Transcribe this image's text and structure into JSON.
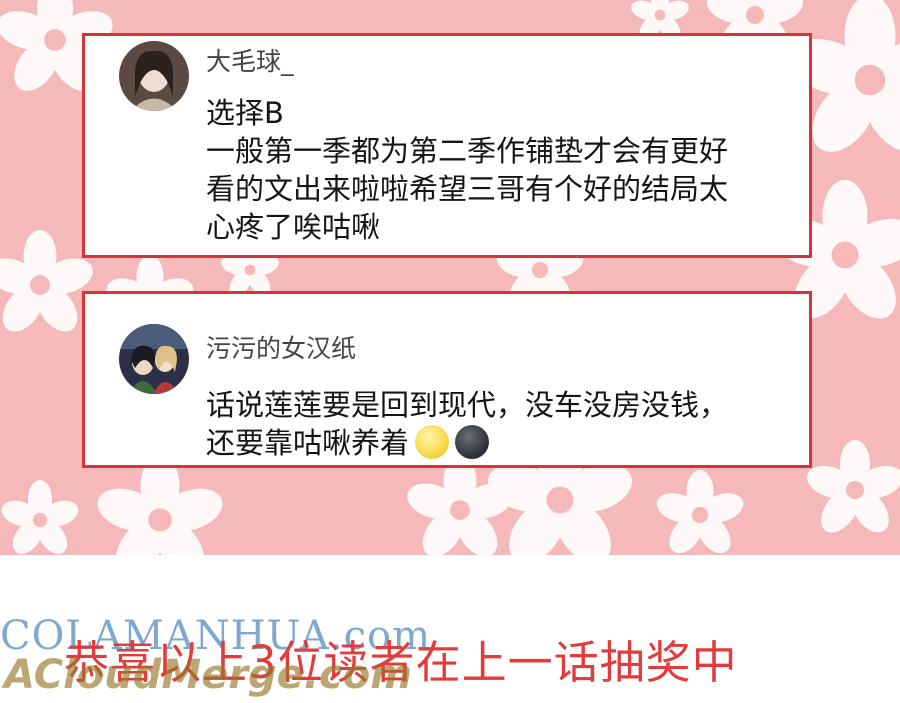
{
  "colors": {
    "background": "#f6b9b9",
    "card_border": "#d6343a",
    "announcement_text": "#e33b3b"
  },
  "comments": [
    {
      "username": "大毛球_",
      "lines": [
        "选择B",
        "一般第一季都为第二季作铺垫才会有更好",
        "看的文出来啦啦希望三哥有个好的结局太",
        "心疼了唉咕啾"
      ]
    },
    {
      "username": "污污的女汉纸",
      "lines": [
        "话说莲莲要是回到现代，没车没房没钱，",
        "还要靠咕啾养着"
      ],
      "emojis": [
        "sun-face-emoji",
        "new-moon-face-emoji"
      ]
    }
  ],
  "announcement": "恭喜以上3位读者在上一话抽奖中",
  "watermarks": [
    "COLAMANHUA.com",
    "ACloudMerge.com"
  ]
}
